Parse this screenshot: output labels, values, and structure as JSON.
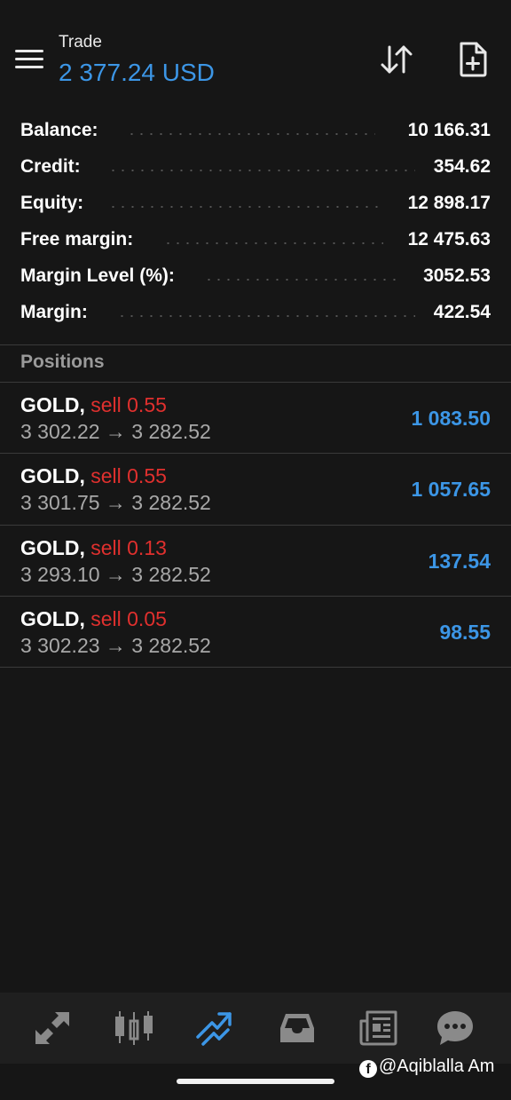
{
  "header": {
    "title": "Trade",
    "balance": "2 377.24 USD"
  },
  "summary": [
    {
      "label": "Balance:",
      "value": "10 166.31"
    },
    {
      "label": "Credit:",
      "value": "354.62"
    },
    {
      "label": "Equity:",
      "value": "12 898.17"
    },
    {
      "label": "Free margin:",
      "value": "12 475.63"
    },
    {
      "label": "Margin Level (%):",
      "value": "3052.53"
    },
    {
      "label": "Margin:",
      "value": "422.54"
    }
  ],
  "positions": {
    "header": "Positions",
    "items": [
      {
        "symbol": "GOLD,",
        "side": "sell 0.55",
        "prices": "3 302.22 → 3 282.52",
        "profit": "1 083.50"
      },
      {
        "symbol": "GOLD,",
        "side": "sell 0.55",
        "prices": "3 301.75 → 3 282.52",
        "profit": "1 057.65"
      },
      {
        "symbol": "GOLD,",
        "side": "sell 0.13",
        "prices": "3 293.10 → 3 282.52",
        "profit": "137.54"
      },
      {
        "symbol": "GOLD,",
        "side": "sell 0.05",
        "prices": "3 302.23 → 3 282.52",
        "profit": "98.55"
      }
    ]
  },
  "nav": {
    "items": [
      "quotes-icon",
      "chart-icon",
      "trade-icon",
      "history-icon",
      "news-icon",
      "chat-icon"
    ],
    "active": "trade-icon"
  },
  "watermark": {
    "icon": "facebook-icon",
    "text": "@Aqiblalla Am"
  },
  "colors": {
    "accent": "#3c96e6",
    "sell": "#e0302e",
    "background": "#161616"
  }
}
